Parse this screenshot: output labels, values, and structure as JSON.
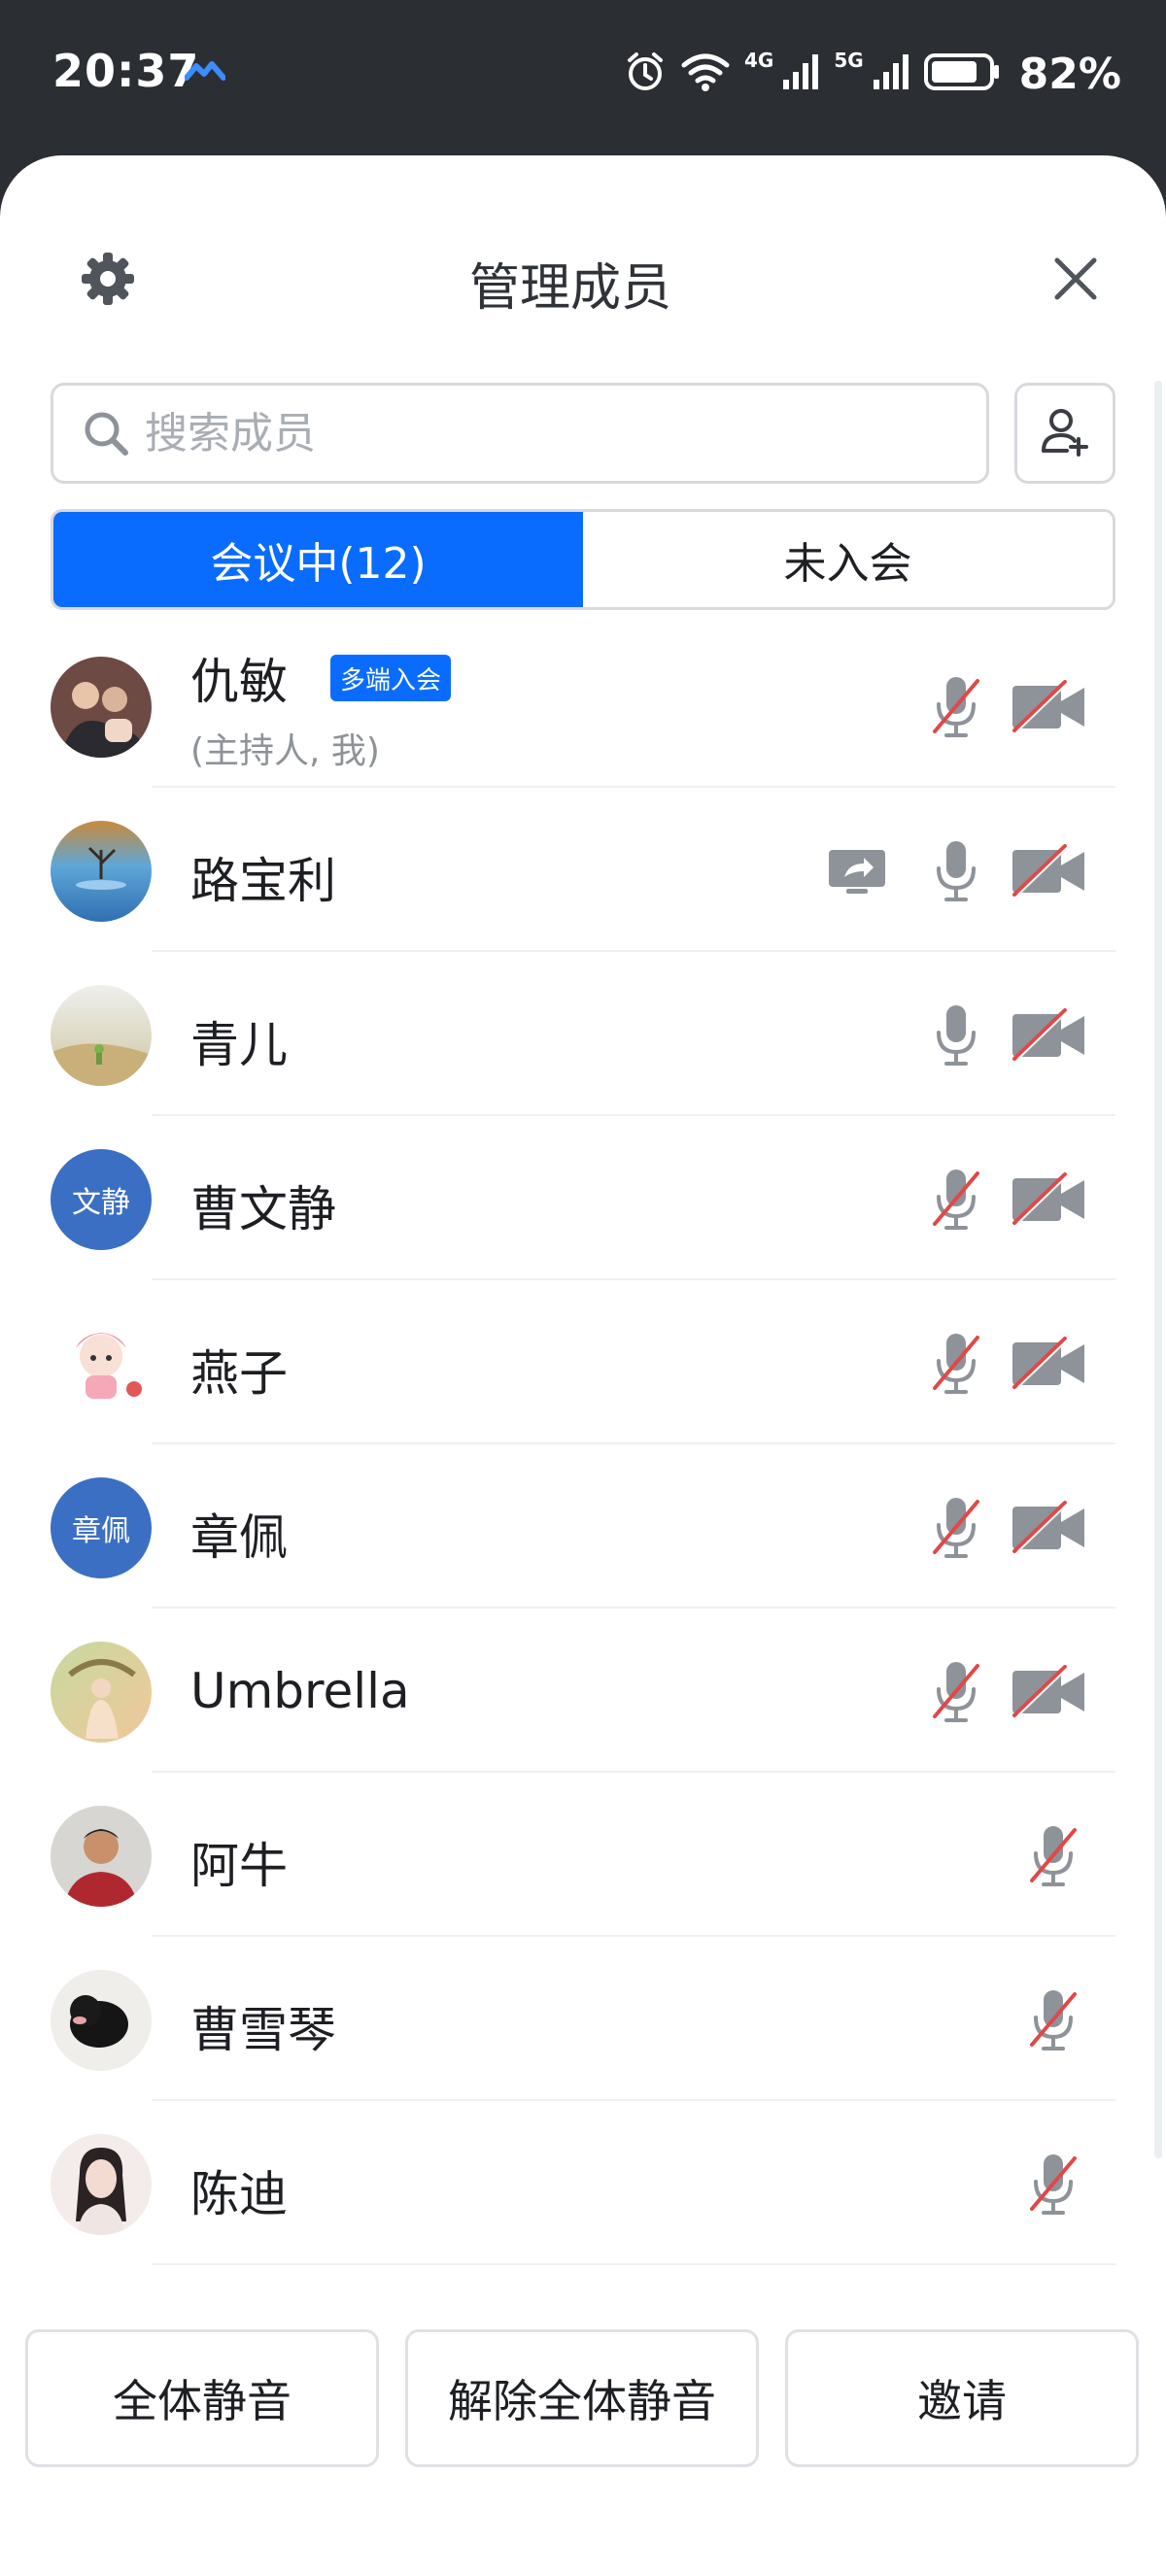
{
  "status_bar": {
    "time": "20:37",
    "net_4g": "4G",
    "net_5g": "5G",
    "battery_percent": "82%",
    "battery_level": 0.82
  },
  "header": {
    "title": "管理成员",
    "settings_icon": "gear-icon",
    "close_icon": "close-icon"
  },
  "search": {
    "placeholder": "搜索成员"
  },
  "tabs": [
    {
      "label": "会议中(12)",
      "active": true
    },
    {
      "label": "未入会",
      "active": false
    }
  ],
  "members": [
    {
      "name": "仇敏",
      "sub": "(主持人, 我)",
      "badge": "多端入会",
      "sharing": false,
      "mic_muted": true,
      "has_camera": true,
      "camera_off": true
    },
    {
      "name": "路宝利",
      "sharing": true,
      "mic_muted": false,
      "has_camera": true,
      "camera_off": true
    },
    {
      "name": "青儿",
      "sharing": false,
      "mic_muted": false,
      "has_camera": true,
      "camera_off": true
    },
    {
      "name": "曹文静",
      "avatar_text": "文静",
      "sharing": false,
      "mic_muted": true,
      "has_camera": true,
      "camera_off": true
    },
    {
      "name": "燕子",
      "sharing": false,
      "mic_muted": true,
      "has_camera": true,
      "camera_off": true
    },
    {
      "name": "章佩",
      "avatar_text": "章佩",
      "sharing": false,
      "mic_muted": true,
      "has_camera": true,
      "camera_off": true
    },
    {
      "name": "Umbrella",
      "sharing": false,
      "mic_muted": true,
      "has_camera": true,
      "camera_off": true
    },
    {
      "name": "阿牛",
      "sharing": false,
      "mic_muted": true,
      "has_camera": false
    },
    {
      "name": "曹雪琴",
      "sharing": false,
      "mic_muted": true,
      "has_camera": false
    },
    {
      "name": "陈迪",
      "sharing": false,
      "mic_muted": true,
      "has_camera": false
    }
  ],
  "footer": {
    "mute_all": "全体静音",
    "unmute_all": "解除全体静音",
    "invite": "邀请"
  },
  "colors": {
    "accent": "#0a6cff",
    "muted_red": "#e04848",
    "icon_gray": "#8e9299",
    "avatar_blue": "#3b6fc4"
  }
}
